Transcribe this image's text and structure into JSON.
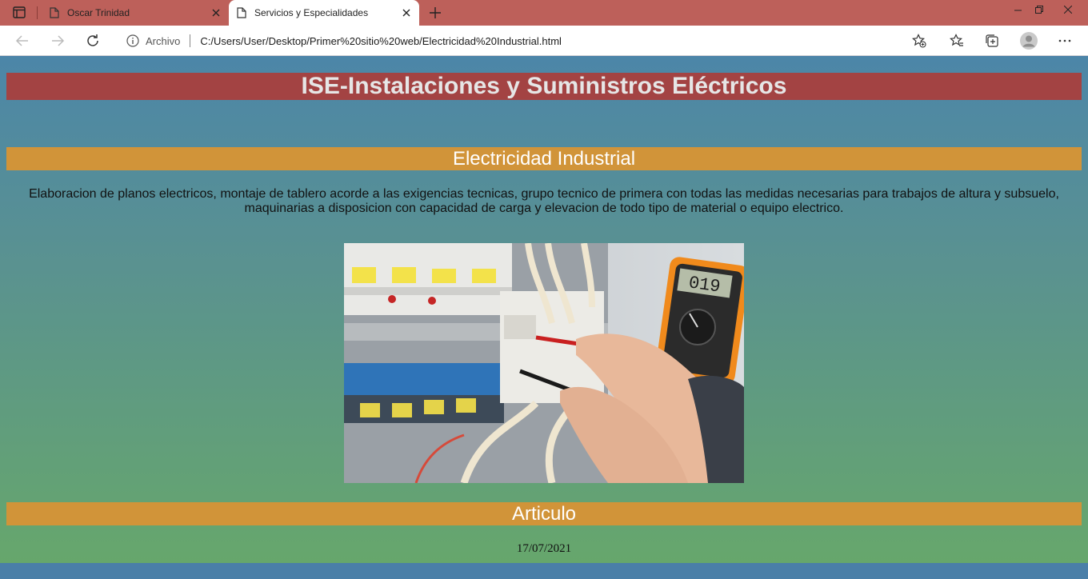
{
  "browser": {
    "tabs": [
      {
        "label": "Oscar Trinidad",
        "active": false
      },
      {
        "label": "Servicios y Especialidades",
        "active": true
      }
    ],
    "address": {
      "scheme_label": "Archivo",
      "url": "C:/Users/User/Desktop/Primer%20sitio%20web/Electricidad%20Industrial.html"
    },
    "icons": [
      "tab-actions-icon",
      "page-icon",
      "close-icon",
      "new-tab-icon",
      "minimize-icon",
      "restore-icon",
      "back-icon",
      "forward-icon",
      "reload-icon",
      "info-icon",
      "add-favorite-icon",
      "favorites-icon",
      "collections-icon",
      "profile-icon",
      "more-icon"
    ]
  },
  "page": {
    "header": "ISE-Instalaciones y Suministros Eléctricos",
    "section_title": "Electricidad Industrial",
    "description": "Elaboracion de planos electricos, montaje de tablero acorde a las exigencias tecnicas, grupo tecnico de primera con todas las medidas necesarias para trabajos de altura y subsuelo, maquinarias a disposicion con capacidad de carga y elevacion de todo tipo de material o equipo electrico.",
    "multimeter_reading": "019",
    "article_title": "Articulo",
    "date": "17/07/2021"
  },
  "colors": {
    "titlebar": "#bd605a",
    "header_bg": "#a34343",
    "section_bg": "#d19439",
    "page_top": "#4c86a8",
    "page_bottom": "#67a86a"
  }
}
